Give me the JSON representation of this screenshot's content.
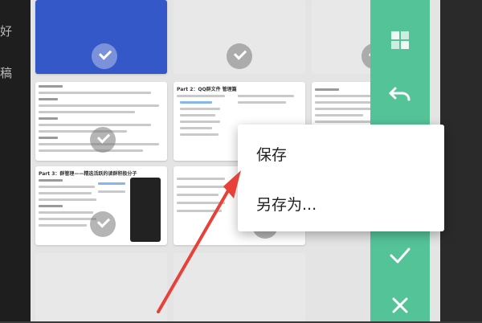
{
  "left_clipped_text": [
    "好",
    "稿"
  ],
  "context_menu": {
    "save_label": "保存",
    "save_as_label": "另存为..."
  },
  "side_panel": {
    "color": "#55c398",
    "buttons": [
      "refresh-icon",
      "layers-icon",
      "undo-icon",
      "confirm-check-icon",
      "close-icon"
    ]
  },
  "thumbnails": {
    "part2_title": "Part 2：QQ群文件 管理篇",
    "part3_title": "Part 3：群管理——精选活跃的读群积极分子"
  },
  "annotation": {
    "arrow_color": "#e8413a"
  },
  "colors": {
    "accent_blue": "#3558c8",
    "arrow_red": "#e8413a"
  }
}
